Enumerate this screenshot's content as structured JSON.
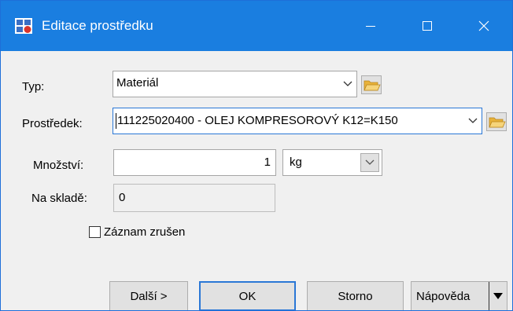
{
  "window": {
    "title": "Editace prostředku",
    "icons": {
      "app": "app-icon",
      "minimize": "minimize-icon",
      "maximize": "maximize-icon",
      "close": "close-icon"
    }
  },
  "form": {
    "typ": {
      "label": "Typ:",
      "value": "Materiál"
    },
    "prostredek": {
      "label": "Prostředek:",
      "value": "111225020400 - OLEJ KOMPRESOROVÝ    K12=K150"
    },
    "mnozstvi": {
      "label": "Množství:",
      "value": "1",
      "unit": "kg"
    },
    "na_sklade": {
      "label": "Na skladě:",
      "value": "0"
    },
    "zaznam_zrusen": {
      "label": "Záznam zrušen",
      "checked": false
    }
  },
  "buttons": {
    "dalsi": "Další >",
    "ok": "OK",
    "storno": "Storno",
    "napoveda": "Nápověda"
  },
  "colors": {
    "titlebar": "#1a7ee0",
    "focus": "#2a77d6",
    "folder": "#f2c14e"
  }
}
